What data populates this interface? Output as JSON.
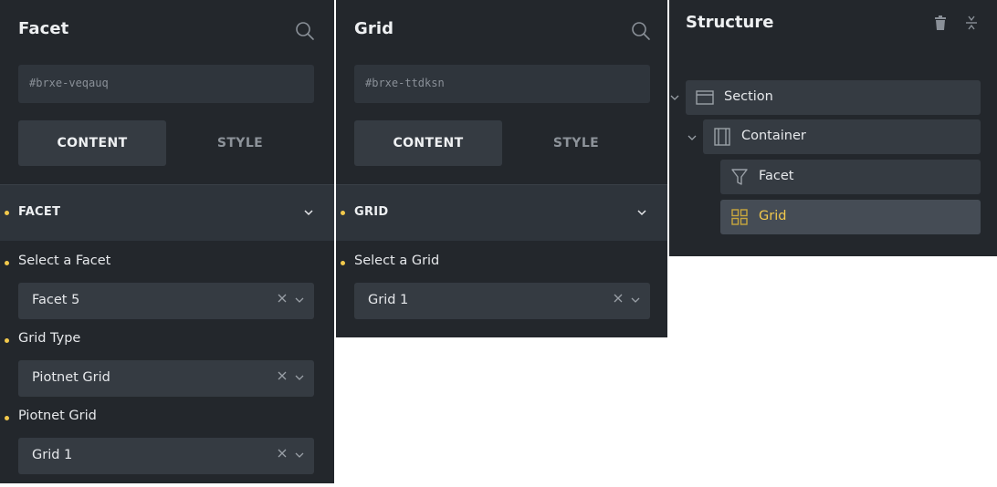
{
  "colors": {
    "accent": "#f2c94c",
    "panel_bg": "#23272c"
  },
  "facet_panel": {
    "title": "Facet",
    "search_icon": "search-icon",
    "element_id": "#brxe-veqauq",
    "tabs": {
      "content": "CONTENT",
      "style": "STYLE"
    },
    "section": {
      "title": "FACET"
    },
    "fields": [
      {
        "label": "Select a Facet",
        "value": "Facet 5"
      },
      {
        "label": "Grid Type",
        "value": "Piotnet Grid"
      },
      {
        "label": "Piotnet Grid",
        "value": "Grid 1"
      }
    ]
  },
  "grid_panel": {
    "title": "Grid",
    "search_icon": "search-icon",
    "element_id": "#brxe-ttdksn",
    "tabs": {
      "content": "CONTENT",
      "style": "STYLE"
    },
    "section": {
      "title": "GRID"
    },
    "fields": [
      {
        "label": "Select a Grid",
        "value": "Grid 1"
      }
    ]
  },
  "structure_panel": {
    "title": "Structure",
    "tree": [
      {
        "label": "Section",
        "icon": "section-icon",
        "expanded": true
      },
      {
        "label": "Container",
        "icon": "container-icon",
        "expanded": true
      },
      {
        "label": "Facet",
        "icon": "filter-icon"
      },
      {
        "label": "Grid",
        "icon": "grid-icon",
        "selected": true
      }
    ]
  }
}
